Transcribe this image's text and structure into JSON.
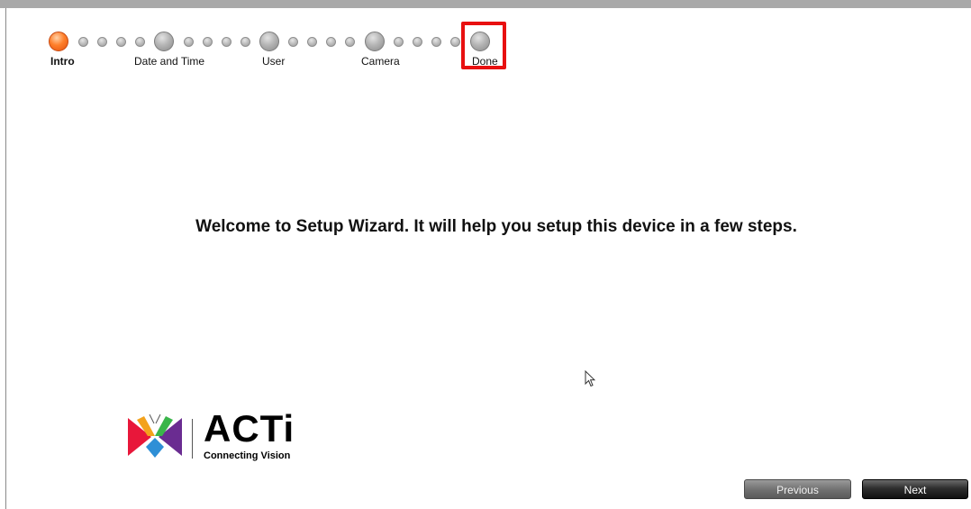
{
  "wizard": {
    "steps": [
      {
        "label": "Intro",
        "state": "active",
        "color": "#ff7f2a"
      },
      {
        "label": "Date and Time",
        "state": "inactive"
      },
      {
        "label": "User",
        "state": "inactive"
      },
      {
        "label": "Camera",
        "state": "inactive"
      },
      {
        "label": "Done",
        "state": "inactive",
        "highlight_color": "#e81010"
      }
    ]
  },
  "main": {
    "welcome_text": "Welcome to Setup Wizard. It will help you setup this device in a few steps."
  },
  "logo": {
    "wordmark": "ACTi",
    "tagline": "Connecting Vision"
  },
  "footer": {
    "previous_label": "Previous",
    "next_label": "Next"
  },
  "colors": {
    "accent": "#ff7f2a",
    "highlight": "#e81010"
  }
}
